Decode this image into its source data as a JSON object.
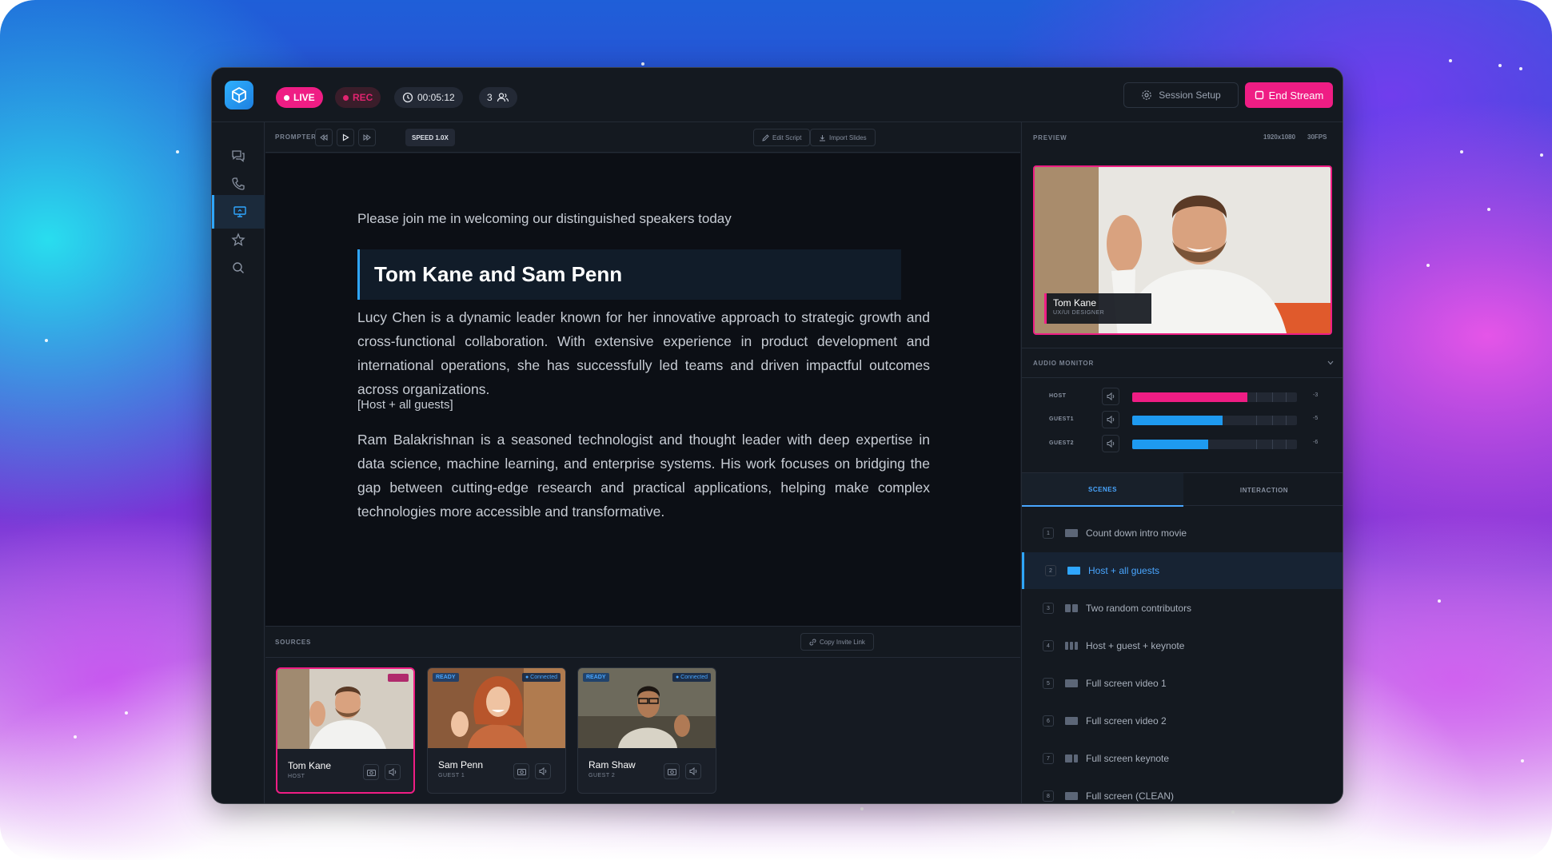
{
  "topbar": {
    "live_label": "LIVE",
    "rec_label": "REC",
    "timer": "00:05:12",
    "participants": "3",
    "session_setup": "Session Setup",
    "end_stream": "End Stream"
  },
  "sidebar": {
    "items": [
      {
        "icon": "chat-icon"
      },
      {
        "icon": "phone-icon"
      },
      {
        "icon": "screen-share-icon"
      },
      {
        "icon": "star-icon"
      },
      {
        "icon": "search-icon"
      }
    ]
  },
  "prompter": {
    "label": "PROMPTER",
    "speed": "SPEED 1.0X",
    "edit_script": "Edit Script",
    "import_slides": "Import Slides"
  },
  "script": {
    "intro": "Please join me in welcoming our distinguished speakers today",
    "headline": "Tom Kane and Sam Penn",
    "para1": "Lucy Chen is a dynamic leader known for her innovative approach to strategic growth and cross-functional collaboration. With extensive experience in product development and international operations, she has successfully led teams and driven impactful outcomes across organizations.",
    "note": "[Host + all guests]",
    "para2": "Ram Balakrishnan is a seasoned technologist and thought leader with deep expertise in data science, machine learning, and enterprise systems. His work focuses on bridging the gap between cutting-edge research and practical applications, helping make complex technologies more accessible and transformative."
  },
  "sources": {
    "label": "SOURCES",
    "copy_invite": "Copy Invite Link",
    "cards": [
      {
        "name": "Tom Kane",
        "role": "HOST"
      },
      {
        "name": "Sam Penn",
        "role": "GUEST 1",
        "status": "READY",
        "connection": "Connected"
      },
      {
        "name": "Ram Shaw",
        "role": "GUEST 2",
        "status": "READY",
        "connection": "Connected"
      }
    ]
  },
  "preview": {
    "label": "PREVIEW",
    "resolution": "1920x1080",
    "fps": "30FPS",
    "name": "Tom Kane",
    "title": "UX/UI DESIGNER"
  },
  "audio": {
    "label": "AUDIO MONITOR",
    "rows": [
      {
        "name": "HOST",
        "level": 0.7,
        "db": "-3",
        "color": "#ef1d84"
      },
      {
        "name": "GUEST1",
        "level": 0.55,
        "db": "-5",
        "color": "#1e9af0"
      },
      {
        "name": "GUEST2",
        "level": 0.46,
        "db": "-6",
        "color": "#1e9af0"
      }
    ]
  },
  "tabs": {
    "scenes": "SCENES",
    "interaction": "INTERACTION"
  },
  "scenes": [
    {
      "num": "1",
      "label": "Count down intro movie"
    },
    {
      "num": "2",
      "label": "Host + all guests"
    },
    {
      "num": "3",
      "label": "Two random contributors"
    },
    {
      "num": "4",
      "label": "Host + guest + keynote"
    },
    {
      "num": "5",
      "label": "Full screen video 1"
    },
    {
      "num": "6",
      "label": "Full screen video 2"
    },
    {
      "num": "7",
      "label": "Full screen keynote"
    },
    {
      "num": "8",
      "label": "Full screen (CLEAN)"
    }
  ]
}
